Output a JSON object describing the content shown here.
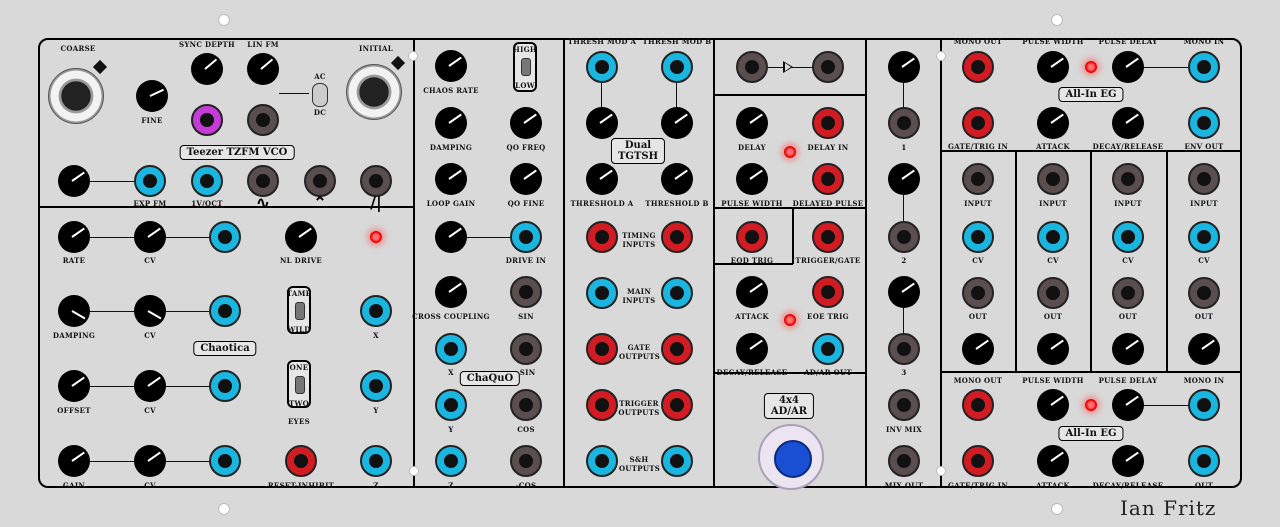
{
  "vco": {
    "coarse": "COARSE",
    "sync_depth": "SYNC DEPTH",
    "lin_fm": "LIN FM",
    "initial": "INITIAL",
    "fine": "FINE",
    "ac": "AC",
    "dc": "DC",
    "title": "Teezer TZFM VCO",
    "exp_fm": "EXP FM",
    "v_oct": "1V/OCT",
    "wave_sine": "∿",
    "wave_tri": "⌃",
    "wave_saw": "/|"
  },
  "chaotica": {
    "rate": "RATE",
    "cv": "CV",
    "nl_drive": "NL DRIVE",
    "damping": "DAMPING",
    "tame": "TAME",
    "wild": "WILD",
    "x": "X",
    "title": "Chaotica",
    "offset": "OFFSET",
    "one": "ONE",
    "two": "TWO",
    "eyes": "EYES",
    "y": "Y",
    "gain": "GAIN",
    "reset_inhibit": "RESET-INHIBIT",
    "z": "Z"
  },
  "chaquo": {
    "chaos_rate": "CHAOS RATE",
    "high": "HIGH",
    "low": "LOW",
    "damping": "DAMPING",
    "qo_freq": "QO FREQ",
    "loop_gain": "LOOP GAIN",
    "qo_fine": "QO FINE",
    "drive_in": "DRIVE IN",
    "cross_coupling": "CROSS COUPLING",
    "sin": "SIN",
    "x": "X",
    "neg_sin": "-SIN",
    "title": "ChaQuO",
    "y": "Y",
    "cos": "COS",
    "z": "Z",
    "neg_cos": "-COS"
  },
  "tgtsh": {
    "thresh_mod_a": "THRESH MOD A",
    "thresh_mod_b": "THRESH MOD B",
    "title_1": "Dual",
    "title_2": "TGTSH",
    "threshold_a": "THRESHOLD A",
    "threshold_b": "THRESHOLD B",
    "timing_inputs": "TIMING INPUTS",
    "main_inputs": "MAIN INPUTS",
    "gate_outputs": "GATE OUTPUTS",
    "trigger_outputs": "TRIGGER OUTPUTS",
    "sh_outputs": "S&H OUTPUTS"
  },
  "adar": {
    "delay": "DELAY",
    "delay_in": "DELAY IN",
    "pulse_width": "PULSE WIDTH",
    "delayed_pulse": "DELAYED PULSE",
    "eod_trig": "EOD TRIG",
    "trigger_gate": "TRIGGER/GATE",
    "attack": "ATTACK",
    "eoe_trig": "EOE TRIG",
    "decay_release": "DECAY/RELEASE",
    "ad_ar_out": "AD/AR OUT",
    "title_1": "4x4",
    "title_2": "AD/AR"
  },
  "mixer": {
    "ch1": "1",
    "ch2": "2",
    "ch3": "3",
    "inv_mix": "INV MIX",
    "mix_out": "MIX OUT"
  },
  "eg": {
    "mono_out": "MONO OUT",
    "pulse_width": "PULSE WIDTH",
    "pulse_delay": "PULSE DELAY",
    "mono_in": "MONO IN",
    "title": "All-In EG",
    "gate_trig_in": "GATE/TRIG IN",
    "attack": "ATTACK",
    "decay_release": "DECAY/RELEASE",
    "env_out": "ENV OUT",
    "out": "OUT"
  },
  "mult": {
    "input": "INPUT",
    "cv": "CV",
    "out": "OUT"
  },
  "brand": "Ian Fritz"
}
